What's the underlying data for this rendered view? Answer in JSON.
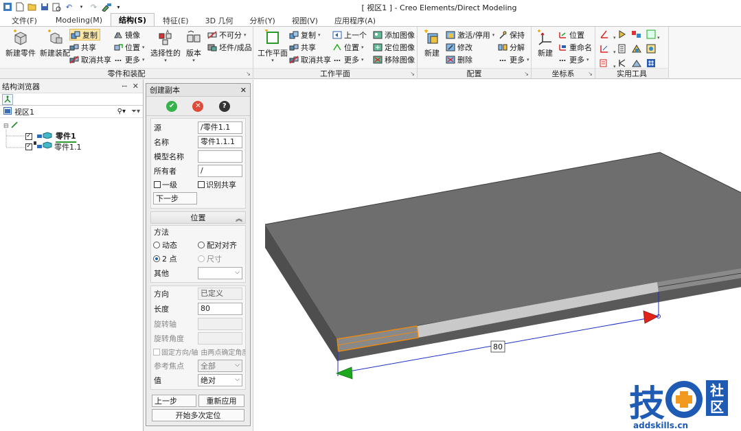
{
  "window": {
    "title": "[ 视区1 ] - Creo Elements/Direct Modeling"
  },
  "quick_access": {
    "icons": [
      "app-icon",
      "new-icon",
      "open-icon",
      "save-icon",
      "print-preview-icon",
      "undo-icon",
      "redo-icon",
      "tools-icon",
      "customize-icon"
    ]
  },
  "tabs": [
    {
      "label": "文件(F)",
      "active": false
    },
    {
      "label": "Modeling(M)",
      "active": false
    },
    {
      "label": "结构(S)",
      "active": true
    },
    {
      "label": "特征(E)",
      "active": false
    },
    {
      "label": "3D 几何",
      "active": false
    },
    {
      "label": "分析(Y)",
      "active": false
    },
    {
      "label": "视图(V)",
      "active": false
    },
    {
      "label": "应用程序(A)",
      "active": false
    }
  ],
  "ribbon": {
    "group_parts": {
      "title": "零件和装配",
      "new_part": "新建零件",
      "new_assembly": "新建装配",
      "copy": "复制",
      "share": "共享",
      "unshare": "取消共享",
      "mirror": "镜像",
      "position": "位置",
      "more": "更多",
      "selective": "选择性的",
      "version": "版本",
      "indivisible": "不可分",
      "stock_finished": "坯件/成品"
    },
    "group_workplane": {
      "title": "工作平面",
      "workplane": "工作平面",
      "copy": "复制",
      "share": "共享",
      "unshare": "取消共享",
      "previous": "上一个",
      "position": "位置",
      "more": "更多",
      "add_image": "添加图像",
      "position_image": "定位图像",
      "remove_image": "移除图像"
    },
    "group_config": {
      "title": "配置",
      "new": "新建",
      "activate": "激活/停用",
      "modify": "修改",
      "delete": "删除",
      "keep": "保持",
      "decompose": "分解",
      "more": "更多"
    },
    "group_coord": {
      "title": "坐标系",
      "new": "新建",
      "position": "位置",
      "rename": "重命名",
      "more": "更多"
    },
    "group_utils": {
      "title": "实用工具"
    }
  },
  "structure_browser": {
    "title": "结构浏览器",
    "view_label": "视区1",
    "items": [
      {
        "label": "零件1",
        "checked": true
      },
      {
        "label": "零件1.1",
        "checked": true
      }
    ]
  },
  "dialog": {
    "title": "创建副本",
    "source_label": "源",
    "source_value": "/零件1.1",
    "name_label": "名称",
    "name_value": "零件1.1.1",
    "model_name_label": "模型名称",
    "model_name_value": "",
    "owner_label": "所有者",
    "owner_value": "/",
    "first_level": "一级",
    "identify_shared": "识别共享",
    "next_button": "下一步",
    "position_section": "位置",
    "method_label": "方法",
    "dynamic": "动态",
    "align": "配对对齐",
    "two_points": "2 点",
    "dimension": "尺寸",
    "other_label": "其他",
    "other_value": "",
    "direction_label": "方向",
    "direction_value": "已定义",
    "length_label": "长度",
    "length_value": "80",
    "rotation_axis_label": "旋转轴",
    "rotation_angle_label": "旋转角度",
    "fix_direction": "固定方向/轴",
    "by_two_points": "由两点确定角度",
    "ref_focus_label": "参考焦点",
    "ref_focus_value": "全部",
    "value_label": "值",
    "value_value": "绝对",
    "prev_button": "上一步",
    "reapply_button": "重新应用",
    "multi_position_button": "开始多次定位"
  },
  "viewport": {
    "dimension_value": "80"
  },
  "watermark": {
    "char_left": "技",
    "char_top": "社",
    "char_bottom": "区",
    "url": "addskills.cn",
    "brand_color": "#1e5bb5",
    "accent_color": "#f29a1f"
  },
  "colors": {
    "accent_orange": "#e98a15",
    "dimension_blue": "#1a2ec8",
    "arrow_green": "#1ea81e",
    "arrow_red": "#e0241a"
  }
}
